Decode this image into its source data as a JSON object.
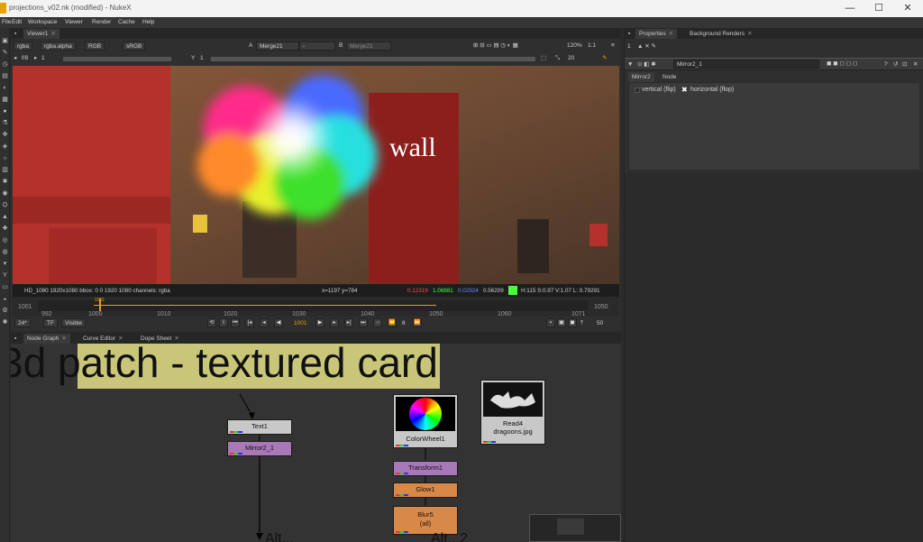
{
  "window": {
    "title": "projections_v02.nk (modified) - NukeX",
    "minimize": "—",
    "maximize": "☐",
    "close": "✕"
  },
  "menu": [
    "File",
    "Edit",
    "Workspace",
    "Viewer",
    "Render",
    "Cache",
    "Help"
  ],
  "viewer": {
    "tab": "Viewer1",
    "channels": "rgba",
    "alpha": "rgba.alpha",
    "colorspace_rgb": "RGB",
    "lut": "sRGB",
    "input_a_label": "A",
    "input_a": "Merge21",
    "blend": "-",
    "input_b_label": "B",
    "input_b": "Merge21",
    "zoom": "120%",
    "ratio": "1:1",
    "fstop": "f/8",
    "frame_step": "1",
    "y_label": "Y",
    "y_value": "1",
    "proxy_scale": "20",
    "image_text": "wall",
    "info_left": "HD_1080 1920x1080  bbox: 0 0 1920 1080 channels: rgba",
    "info_coords": "x=1197 y=784",
    "info_r": "0.12319",
    "info_g": "1.06881",
    "info_b": "0.02924",
    "info_a": "0.56209",
    "info_hsv": "H:115 S:0.97 V:1.07  L: 0.79291",
    "swatch_color": "#4cff3c"
  },
  "timeline": {
    "start": "1001",
    "end": "1050",
    "ticks": [
      "992",
      "1000",
      "1010",
      "1020",
      "1030",
      "1040",
      "1050",
      "1060",
      "1071"
    ],
    "current": "1001",
    "fps": "24*",
    "tf": "TF",
    "visible": "Visible",
    "frame_field": "1001",
    "inc": "8",
    "end_field": "50"
  },
  "nodegraph": {
    "tabs": [
      "Node Graph",
      "Curve Editor",
      "Dope Sheet"
    ],
    "backdrop_text": "3d patch - textured card",
    "nodes": {
      "text": "Text1",
      "mirror": "Mirror2_1",
      "colorwheel": "ColorWheel1",
      "read": "Read4\ndragoons.jpg",
      "read_line1": "Read4",
      "read_line2": "dragoons.jpg",
      "transform": "Transform1",
      "glow": "Glow1",
      "blur_line1": "Blur5",
      "blur_line2": "(all)"
    },
    "bottom_text_1": "Alt...",
    "bottom_text_2": "Alt...2"
  },
  "properties": {
    "tabs": [
      "Properties",
      "Background Renders"
    ],
    "max_panels": "1",
    "node_name": "Mirror2_1",
    "node_tabs": [
      "Mirror2",
      "Node"
    ],
    "vertical_label": "vertical (flip)",
    "horizontal_label": "horizontal (flop)",
    "vertical_checked": false,
    "horizontal_checked": true
  },
  "colors": {
    "accent": "#e8a200",
    "mirror_node": "#a878b8",
    "glow_node": "#d8894a",
    "text_node": "#c8c8c8",
    "backdrop": "#c9c67a"
  }
}
